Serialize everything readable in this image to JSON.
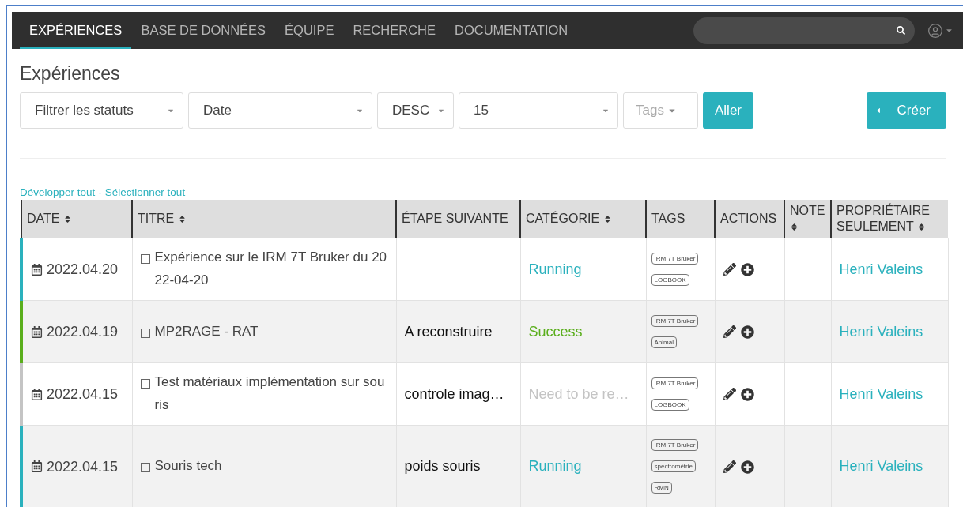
{
  "nav": {
    "tabs": [
      {
        "label": "EXPÉRIENCES",
        "selected": true
      },
      {
        "label": "BASE DE DONNÉES",
        "selected": false
      },
      {
        "label": "ÉQUIPE",
        "selected": false
      },
      {
        "label": "RECHERCHE",
        "selected": false
      },
      {
        "label": "DOCUMENTATION",
        "selected": false
      }
    ]
  },
  "page_title": "Expériences",
  "filters": [
    {
      "kind": "select",
      "value": "Filtrer les statuts"
    },
    {
      "kind": "select",
      "value": "Date"
    },
    {
      "kind": "select",
      "value": "DESC"
    },
    {
      "kind": "select",
      "value": "15"
    },
    {
      "kind": "tags",
      "placeholder": "Tags"
    }
  ],
  "go_button": "Aller",
  "create_button": "Créer",
  "links": [
    "Développer tout",
    "Sélectionner tout"
  ],
  "link_separator": "-",
  "table": {
    "columns": [
      {
        "label": "DATE",
        "sortable": true
      },
      {
        "label": "TITRE",
        "sortable": true
      },
      {
        "label": "ÉTAPE SUIVANTE",
        "sortable": false
      },
      {
        "label": "CATÉGORIE",
        "sortable": true
      },
      {
        "label": "TAGS",
        "sortable": false
      },
      {
        "label": "ACTIONS",
        "sortable": false
      },
      {
        "label": "NOTE",
        "sortable": true
      },
      {
        "label": "PROPRIÉTAIRE SEULEMENT",
        "sortable": true
      }
    ],
    "rows": [
      {
        "date": "2022.04.20",
        "checked": false,
        "title": "Expérience sur le IRM 7T Bruker du 2022-04-20",
        "next_step": "",
        "category": "Running",
        "color": "#2ab1bd",
        "tags": [
          "IRM 7T Bruker",
          "LOGBOOK"
        ],
        "owner": "Henri Valeins"
      },
      {
        "date": "2022.04.19",
        "checked": false,
        "title": "MP2RAGE - RAT",
        "next_step": "A reconstruire",
        "category": "Success",
        "color": "#5aae1c",
        "tags": [
          "IRM 7T Bruker",
          "Animal"
        ],
        "owner": "Henri Valeins"
      },
      {
        "date": "2022.04.15",
        "checked": false,
        "title": "Test matériaux implémentation sur souris",
        "next_step": "controle imag…",
        "category": "Need to be re…",
        "color": "#c4c4c4",
        "tags": [
          "IRM 7T Bruker",
          "LOGBOOK"
        ],
        "owner": "Henri Valeins"
      },
      {
        "date": "2022.04.15",
        "checked": false,
        "title": "Souris tech",
        "next_step": "poids souris",
        "category": "Running",
        "color": "#2ab1bd",
        "tags": [
          "IRM 7T Bruker",
          "spectrométrie",
          "RMN"
        ],
        "owner": "Henri Valeins"
      }
    ]
  }
}
